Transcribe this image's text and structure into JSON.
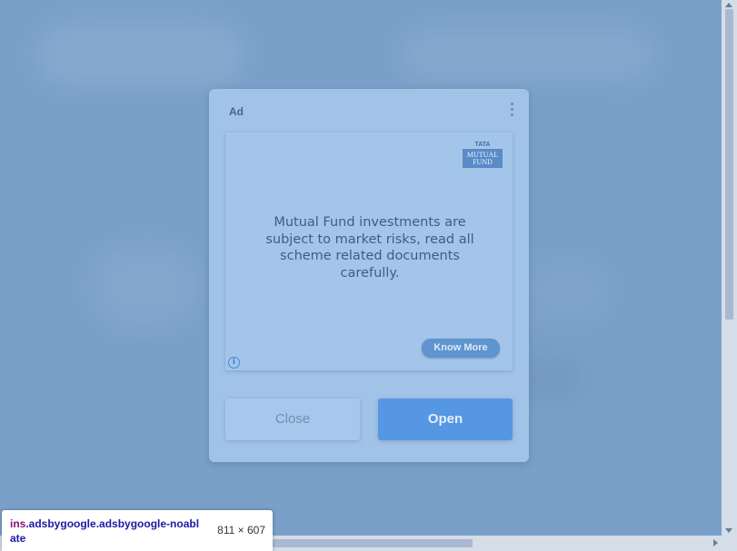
{
  "ad": {
    "label": "Ad",
    "brand": {
      "top": "TATA",
      "line1": "MUTUAL",
      "line2": "FUND"
    },
    "disclaimer": "Mutual Fund investments are subject to market risks, read all scheme related documents carefully.",
    "cta_label": "Know More",
    "info_icon": "i"
  },
  "buttons": {
    "close_label": "Close",
    "open_label": "Open"
  },
  "devtools": {
    "tag": "ins",
    "classes": ".adsbygoogle.adsbygoogle-noablate",
    "dimensions": "811 × 607"
  },
  "colors": {
    "overlay": "#7ba0c8",
    "dialog": "#a1c3e8",
    "open_button": "#5597e3",
    "know_more": "#5f94cf"
  }
}
